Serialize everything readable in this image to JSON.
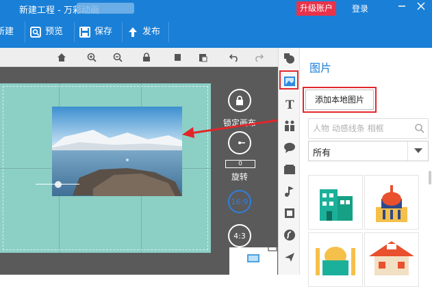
{
  "window": {
    "title": "新建工程 - 万彩动画",
    "upgrade_label": "升级账户",
    "login_label": "登录",
    "minimize_icon": "minimize-icon",
    "close_icon": "close-icon"
  },
  "toolbar": {
    "new_label": "新建",
    "preview_label": "预览",
    "save_label": "保存",
    "publish_label": "发布"
  },
  "canvas": {
    "lock_label": "锁定画布",
    "rotate_label": "旋转",
    "rotate_value": "0",
    "ratio_169": "16:9",
    "ratio_43": "4:3"
  },
  "panel": {
    "title": "图片",
    "add_local_label": "添加本地图片",
    "search_placeholder": "人物 动感线条 相框",
    "category_selected": "所有"
  },
  "colors": {
    "title_bar": "#1a7fd6",
    "upgrade": "#e8334a",
    "highlight": "#e1262b",
    "stage": "#8ccfc5",
    "canvas_bg": "#5a5a5a"
  }
}
